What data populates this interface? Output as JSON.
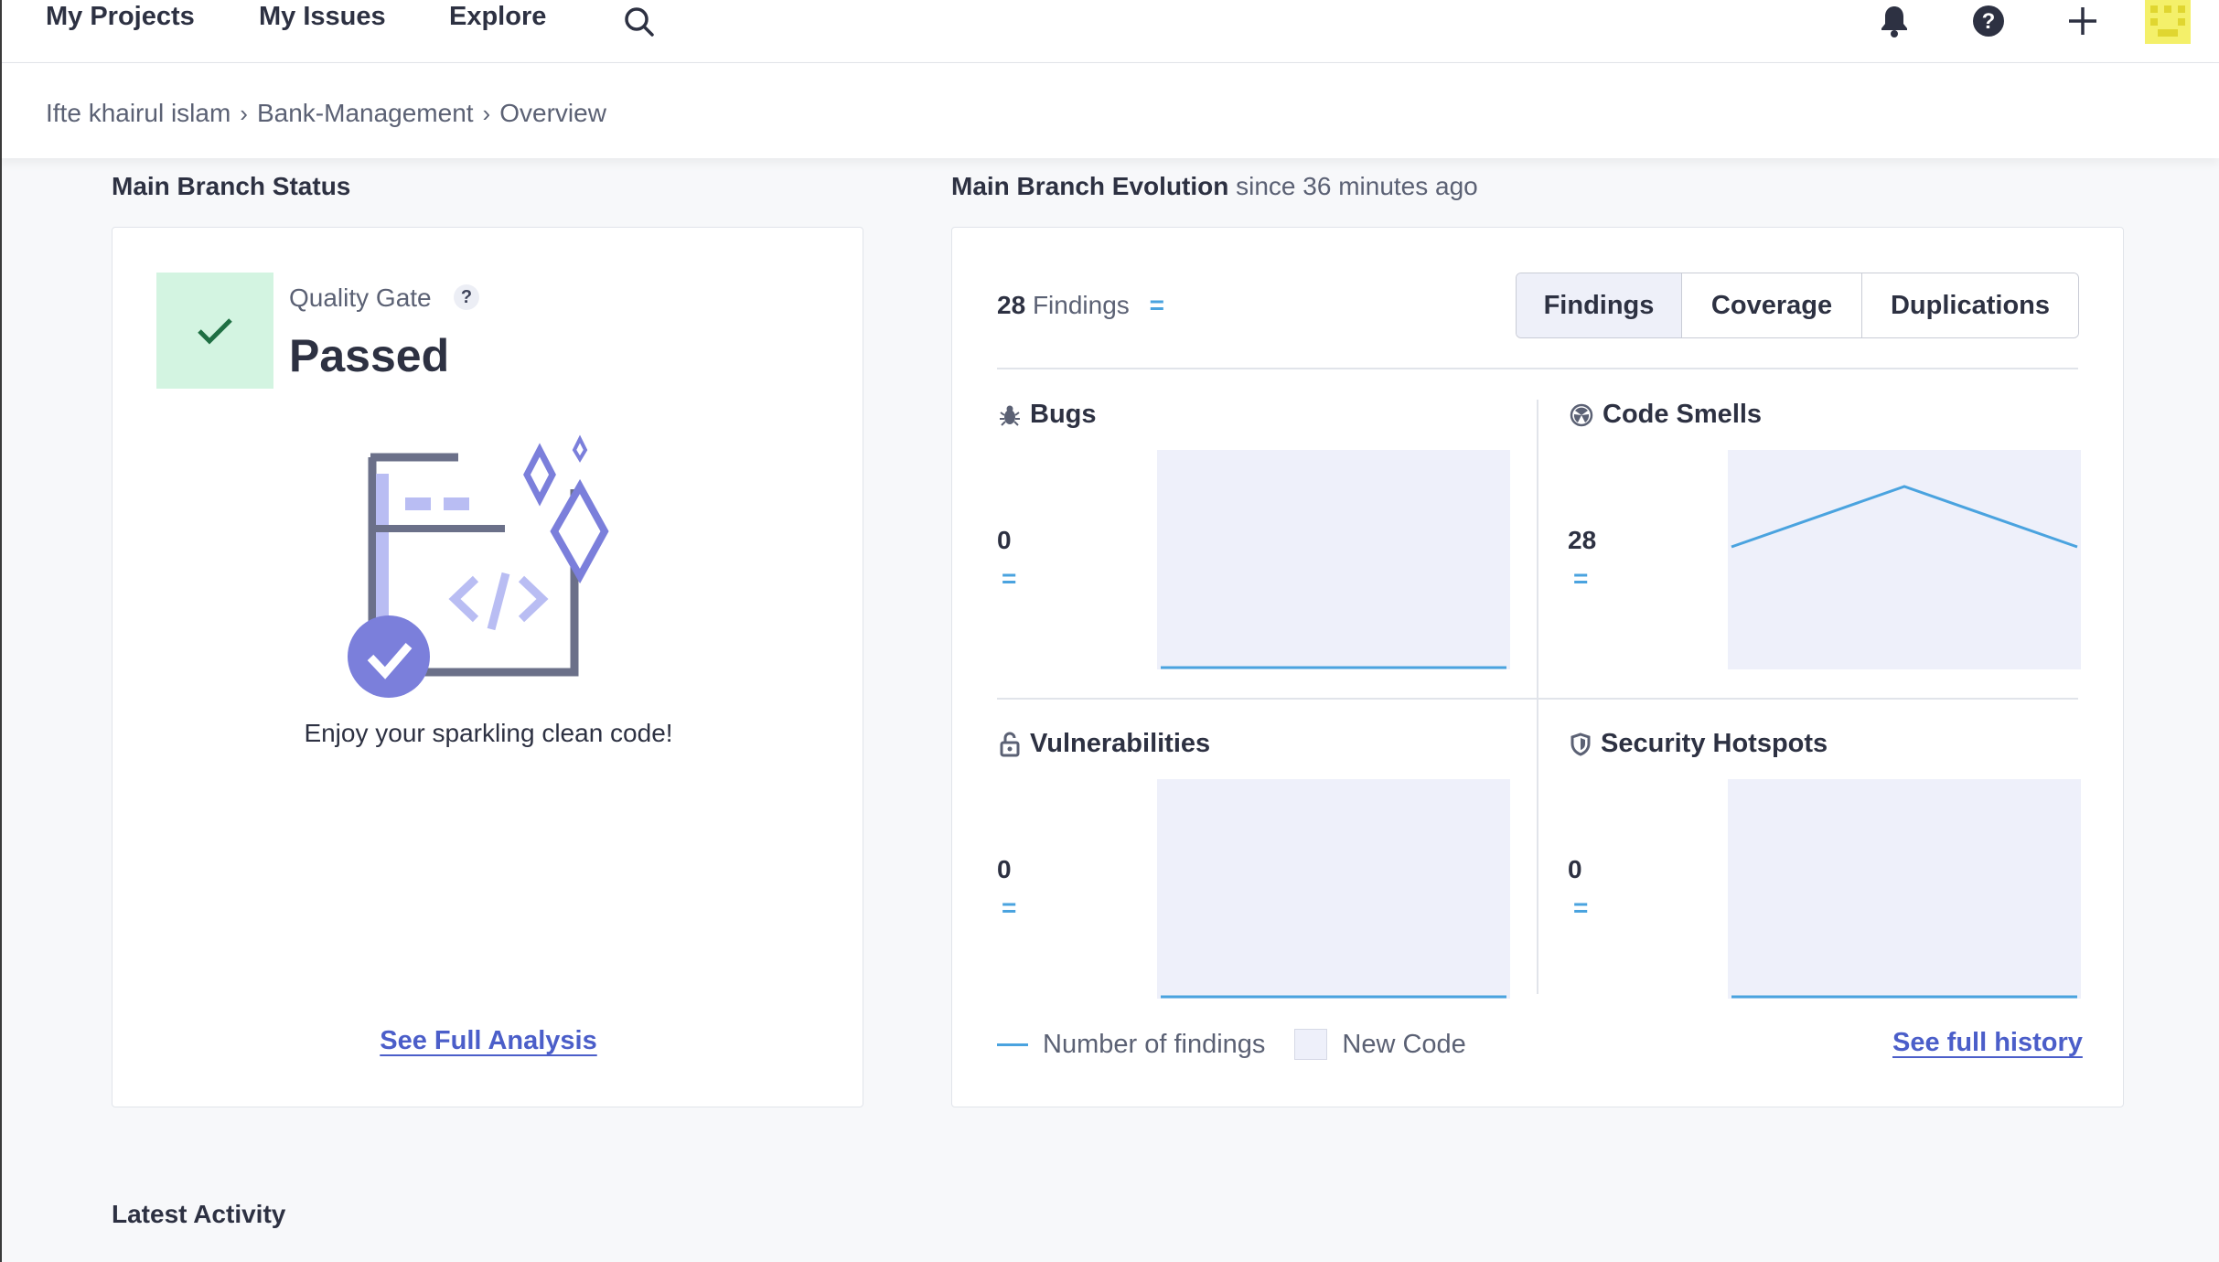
{
  "nav": {
    "my_projects": "My Projects",
    "my_issues": "My Issues",
    "explore": "Explore",
    "icons": [
      "search-icon",
      "bell-icon",
      "help-icon",
      "plus-icon",
      "avatar"
    ]
  },
  "breadcrumb": {
    "items": [
      "Ifte khairul islam",
      "Bank-Management",
      "Overview"
    ]
  },
  "main_branch_status": {
    "title": "Main Branch Status",
    "quality_gate_label": "Quality Gate",
    "help": "?",
    "status": "Passed",
    "message": "Enjoy your sparkling clean code!",
    "link": "See Full Analysis"
  },
  "evolution": {
    "title": "Main Branch Evolution",
    "subtitle": "since 36 minutes ago",
    "findings_count": "28",
    "findings_label": "Findings",
    "findings_trend": "=",
    "tabs": [
      "Findings",
      "Coverage",
      "Duplications"
    ],
    "active_tab": "Findings",
    "metrics": {
      "bugs": {
        "title": "Bugs",
        "value": "0",
        "trend": "=",
        "series": [
          0,
          0
        ]
      },
      "code_smells": {
        "title": "Code Smells",
        "value": "28",
        "trend": "=",
        "series": [
          18,
          27,
          18
        ]
      },
      "vulnerabilities": {
        "title": "Vulnerabilities",
        "value": "0",
        "trend": "=",
        "series": [
          0,
          0
        ]
      },
      "security_hotspots": {
        "title": "Security Hotspots",
        "value": "0",
        "trend": "=",
        "series": [
          0,
          0
        ]
      }
    },
    "legend": {
      "line": "Number of findings",
      "area": "New Code"
    },
    "link": "See full history",
    "colors": {
      "line": "#4aa3df",
      "new_code": "#eef0fa",
      "accent": "#4b5ec9"
    }
  },
  "latest_activity": {
    "title": "Latest Activity"
  }
}
